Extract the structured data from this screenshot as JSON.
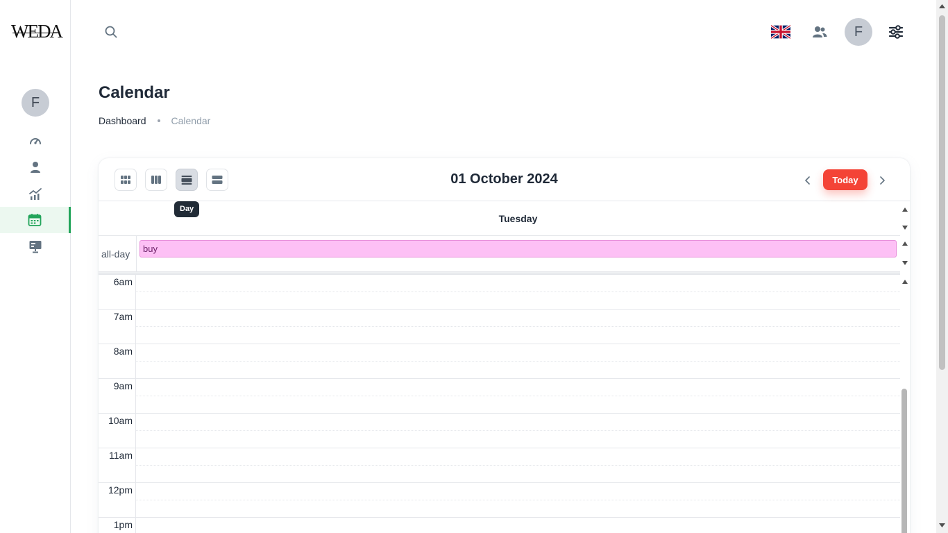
{
  "brand": {
    "logo_text": "WEDA"
  },
  "sidebar": {
    "avatar_initial": "F",
    "items": [
      {
        "name": "dashboard",
        "icon": "speedometer-icon"
      },
      {
        "name": "user",
        "icon": "user-icon"
      },
      {
        "name": "analytics",
        "icon": "chart-icon"
      },
      {
        "name": "calendar",
        "icon": "calendar-icon",
        "active": true
      },
      {
        "name": "kanban",
        "icon": "presentation-icon"
      }
    ]
  },
  "topbar": {
    "search_icon": "search-icon",
    "language_icon": "uk-flag-icon",
    "contacts_icon": "people-icon",
    "avatar_initial": "F",
    "settings_icon": "sliders-icon"
  },
  "page": {
    "title": "Calendar",
    "breadcrumb": {
      "home": "Dashboard",
      "current": "Calendar"
    }
  },
  "calendar": {
    "views": [
      {
        "name": "month",
        "icon": "grid-icon"
      },
      {
        "name": "week",
        "icon": "columns-icon"
      },
      {
        "name": "day",
        "icon": "day-rows-icon",
        "active": true
      },
      {
        "name": "agenda",
        "icon": "list-icon"
      }
    ],
    "tooltip": "Day",
    "current_date": "01 October 2024",
    "today_label": "Today",
    "day_name": "Tuesday",
    "allday_label": "all-day",
    "allday_event": {
      "title": "buy",
      "color": "#fdc0f5"
    },
    "time_labels": [
      "6am",
      "7am",
      "8am",
      "9am",
      "10am",
      "11am",
      "12pm",
      "1pm"
    ]
  },
  "colors": {
    "accent_green": "#22a45a",
    "today_red": "#f44336",
    "event_pink": "#fdc0f5"
  }
}
